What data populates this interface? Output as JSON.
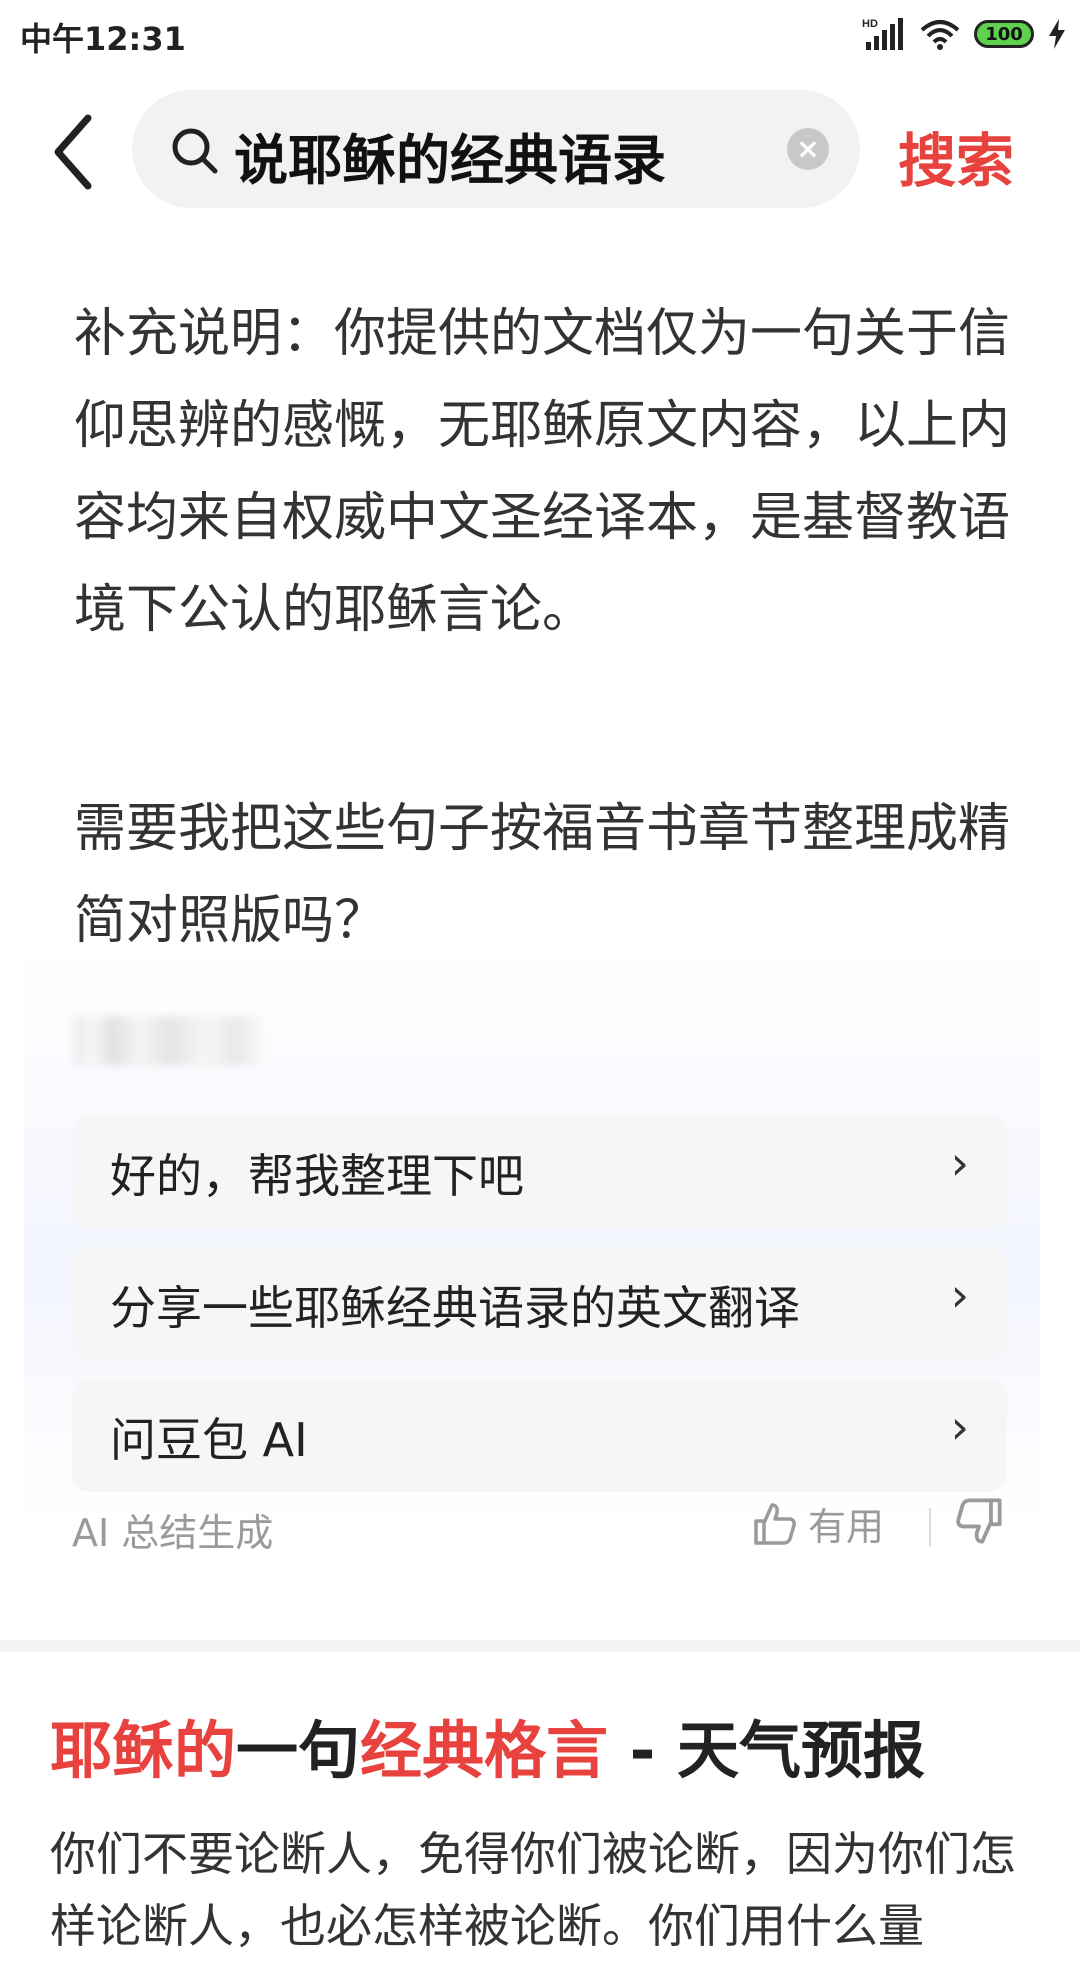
{
  "status_bar": {
    "time": "中午12:31",
    "battery": "100",
    "network": "HD"
  },
  "search": {
    "query": "说耶稣的经典语录",
    "submit_label": "搜索"
  },
  "ai_answer": {
    "paragraph1": "补充说明：你提供的文档仅为一句关于信仰思辨的感慨，无耶稣原文内容，以上内容均来自权威中文圣经译本，是基督教语境下公认的耶稣言论。",
    "paragraph2": "需要我把这些句子按福音书章节整理成精简对照版吗？",
    "suggestions": [
      {
        "label": "好的，帮我整理下吧"
      },
      {
        "label": "分享一些耶稣经典语录的英文翻译"
      },
      {
        "label": "问豆包 AI"
      }
    ],
    "source_label": "AI 总结生成",
    "useful_label": "有用"
  },
  "result": {
    "title_hl1": "耶稣的",
    "title_plain1": "一句",
    "title_hl2": "经典格言",
    "title_plain2": " - 天气预报",
    "snippet": "你们不要论断人，免得你们被论断，因为你们怎样论断人，也必怎样被论断。你们用什么量"
  },
  "colors": {
    "accent": "#e8423e",
    "battery_fill": "#5fd14f"
  }
}
